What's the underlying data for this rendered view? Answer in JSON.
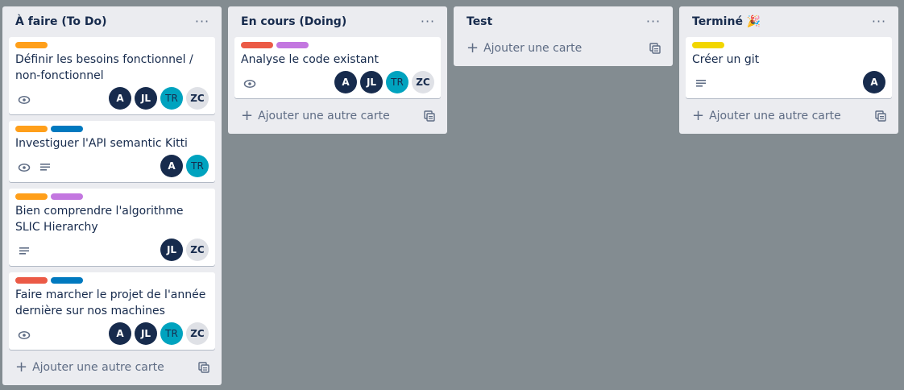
{
  "colors": {
    "orange": "#ff9f1a",
    "blue": "#0079bf",
    "purple": "#c377e0",
    "red": "#eb5a46",
    "yellow": "#f2d600"
  },
  "lists": [
    {
      "title": "À faire (To Do)",
      "menu": "···",
      "add_label": "Ajouter une autre carte",
      "cards": [
        {
          "title": "Définir les besoins fonctionnel / non-fonctionnel",
          "members": [
            "A",
            "JL",
            "TR",
            "ZC"
          ]
        },
        {
          "title": "Investiguer l'API semantic Kitti",
          "members": [
            "A",
            "TR"
          ]
        },
        {
          "title": "Bien comprendre l'algorithme SLIC Hierarchy",
          "members": [
            "JL",
            "ZC"
          ]
        },
        {
          "title": "Faire marcher le projet de l'année dernière sur nos machines",
          "members": [
            "A",
            "JL",
            "TR",
            "ZC"
          ]
        }
      ]
    },
    {
      "title": "En cours (Doing)",
      "menu": "···",
      "add_label": "Ajouter une autre carte",
      "cards": [
        {
          "title": "Analyse le code existant",
          "members": [
            "A",
            "JL",
            "TR",
            "ZC"
          ]
        }
      ]
    },
    {
      "title": "Test",
      "menu": "···",
      "add_label": "Ajouter une carte",
      "cards": []
    },
    {
      "title": "Terminé 🎉",
      "menu": "···",
      "add_label": "Ajouter une autre carte",
      "cards": [
        {
          "title": "Créer un git",
          "members": [
            "A"
          ]
        }
      ]
    }
  ]
}
